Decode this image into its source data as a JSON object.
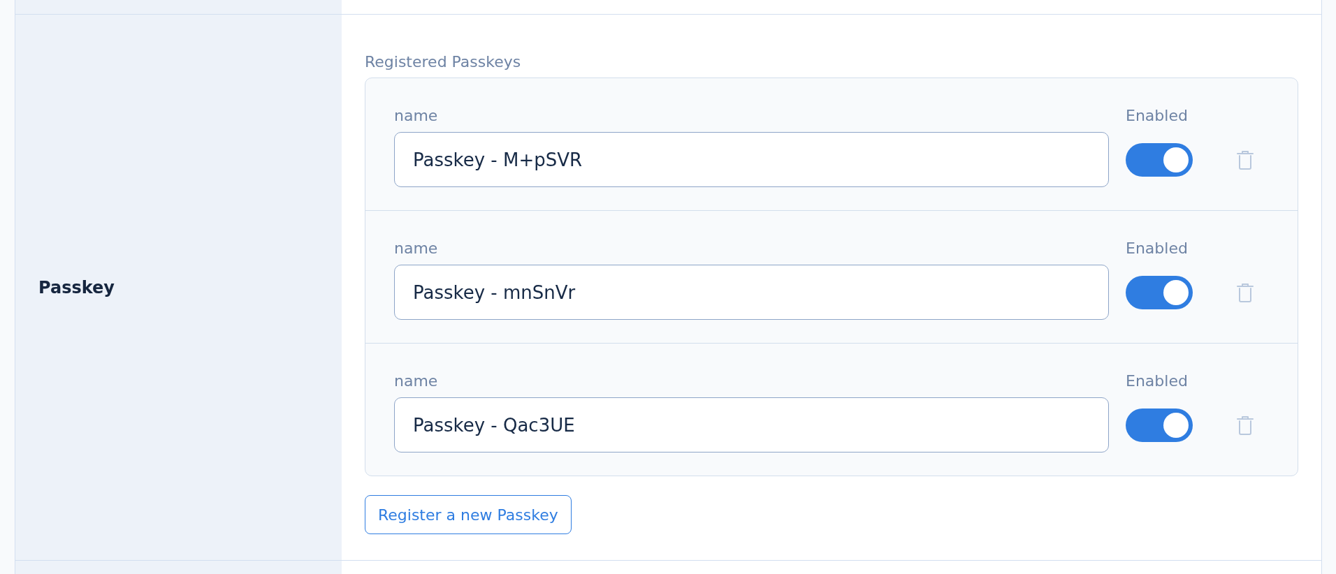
{
  "section": {
    "label": "Passkey"
  },
  "passkeys": {
    "title": "Registered Passkeys",
    "items": [
      {
        "name_label": "name",
        "value": "Passkey - M+pSVR",
        "enabled_label": "Enabled",
        "enabled": true
      },
      {
        "name_label": "name",
        "value": "Passkey - mnSnVr",
        "enabled_label": "Enabled",
        "enabled": true
      },
      {
        "name_label": "name",
        "value": "Passkey - Qac3UE",
        "enabled_label": "Enabled",
        "enabled": true
      }
    ]
  },
  "register_button": "Register a new Passkey"
}
